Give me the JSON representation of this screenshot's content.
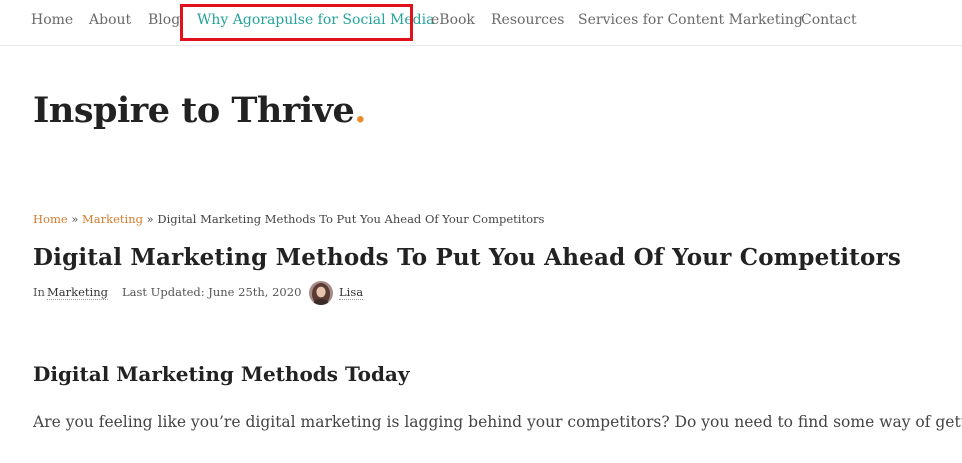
{
  "nav": {
    "items": [
      {
        "label": "Home"
      },
      {
        "label": "About"
      },
      {
        "label": "Blog"
      },
      {
        "label": "Why Agorapulse for Social Media"
      },
      {
        "label": "eBook"
      },
      {
        "label": "Resources"
      },
      {
        "label": "Services for Content Marketing"
      },
      {
        "label": "Contact"
      }
    ],
    "active_index": 3,
    "active_color": "#24a39a",
    "highlight_color": "#e2101b"
  },
  "site": {
    "title": "Inspire to Thrive",
    "title_dot": ".",
    "accent_color": "#e98d2b"
  },
  "breadcrumb": {
    "home": "Home",
    "separator": "»",
    "category": "Marketing",
    "current": "Digital Marketing Methods To Put You Ahead Of Your Competitors"
  },
  "post": {
    "title": "Digital Marketing Methods To Put You Ahead Of Your Competitors",
    "meta": {
      "in_label": "In",
      "category": "Marketing",
      "updated": "Last Updated: June 25th, 2020",
      "author": "Lisa",
      "avatar_icon": "author-avatar"
    },
    "section_heading": "Digital Marketing Methods Today",
    "paragraph": "Are you feeling like you’re digital marketing is lagging behind your competitors? Do you need to find some way of getting ahead"
  }
}
